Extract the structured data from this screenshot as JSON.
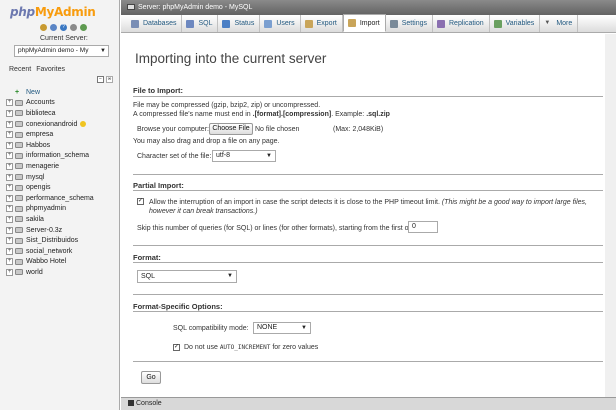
{
  "nav": {
    "logo": {
      "php": "php",
      "my": "My",
      "admin": "Admin"
    },
    "current_server_label": "Current Server:",
    "server_select_value": "phpMyAdmin demo - My",
    "recent_tab": "Recent",
    "favorites_tab": "Favorites",
    "databases": [
      {
        "label": "New",
        "type": "new"
      },
      {
        "label": "Accounts"
      },
      {
        "label": "biblioteca"
      },
      {
        "label": "conexionandroid",
        "badge": true
      },
      {
        "label": "empresa"
      },
      {
        "label": "Habbos"
      },
      {
        "label": "information_schema"
      },
      {
        "label": "menagerie"
      },
      {
        "label": "mysql"
      },
      {
        "label": "opengis"
      },
      {
        "label": "performance_schema"
      },
      {
        "label": "phpmyadmin"
      },
      {
        "label": "sakila"
      },
      {
        "label": "Server-0.3z"
      },
      {
        "label": "Sist_Distribuidos"
      },
      {
        "label": "social_network"
      },
      {
        "label": "Wabbo Hotel"
      },
      {
        "label": "world"
      }
    ]
  },
  "serverbar": {
    "text": "Server: phpMyAdmin demo - MySQL"
  },
  "tabs": [
    {
      "label": "Databases",
      "icon": "database-icon",
      "color": "#7a8eb5"
    },
    {
      "label": "SQL",
      "icon": "sql-icon",
      "color": "#6d88c0"
    },
    {
      "label": "Status",
      "icon": "status-icon",
      "color": "#4b7fc5"
    },
    {
      "label": "Users",
      "icon": "users-icon",
      "color": "#7b9fd0"
    },
    {
      "label": "Export",
      "icon": "export-icon",
      "color": "#c9a55a"
    },
    {
      "label": "Import",
      "icon": "import-icon",
      "color": "#c9a55a",
      "active": true
    },
    {
      "label": "Settings",
      "icon": "settings-icon",
      "color": "#7a8a99"
    },
    {
      "label": "Replication",
      "icon": "replication-icon",
      "color": "#8a6fb0"
    },
    {
      "label": "Variables",
      "icon": "variables-icon",
      "color": "#6aa060"
    },
    {
      "label": "More",
      "icon": "more-icon",
      "color": "#555555"
    }
  ],
  "page": {
    "title": "Importing into the current server",
    "file_to_import": {
      "legend": "File to Import:",
      "line1": "File may be compressed (gzip, bzip2, zip) or uncompressed.",
      "line2_pre": "A compressed file's name must end in ",
      "line2_bold": ".[format].[compression]",
      "line2_mid": ". Example: ",
      "line2_example": ".sql.zip",
      "browse_label": "Browse your computer:",
      "choose_file_button": "Choose File",
      "no_file_text": "No file chosen",
      "max_size": "(Max: 2,048KiB)",
      "drag_drop_text": "You may also drag and drop a file on any page.",
      "charset_label": "Character set of the file:",
      "charset_value": "utf-8"
    },
    "partial_import": {
      "legend": "Partial Import:",
      "allow_interrupt_text": "Allow the interruption of an import in case the script detects it is close to the PHP timeout limit.",
      "allow_interrupt_note": "(This might be a good way to import large files, however it can break transactions.)",
      "allow_interrupt_checked": true,
      "skip_label": "Skip this number of queries (for SQL) or lines (for other formats), starting from the first one:",
      "skip_value": "0"
    },
    "format": {
      "legend": "Format:",
      "value": "SQL"
    },
    "format_options": {
      "legend": "Format-Specific Options:",
      "sql_compat_label": "SQL compatibility mode:",
      "sql_compat_value": "NONE",
      "no_auto_increment_pre": "Do not use ",
      "no_auto_increment_code": "AUTO_INCREMENT",
      "no_auto_increment_post": " for zero values",
      "no_auto_increment_checked": true
    },
    "go_button": "Go"
  },
  "console": {
    "label": "Console"
  }
}
